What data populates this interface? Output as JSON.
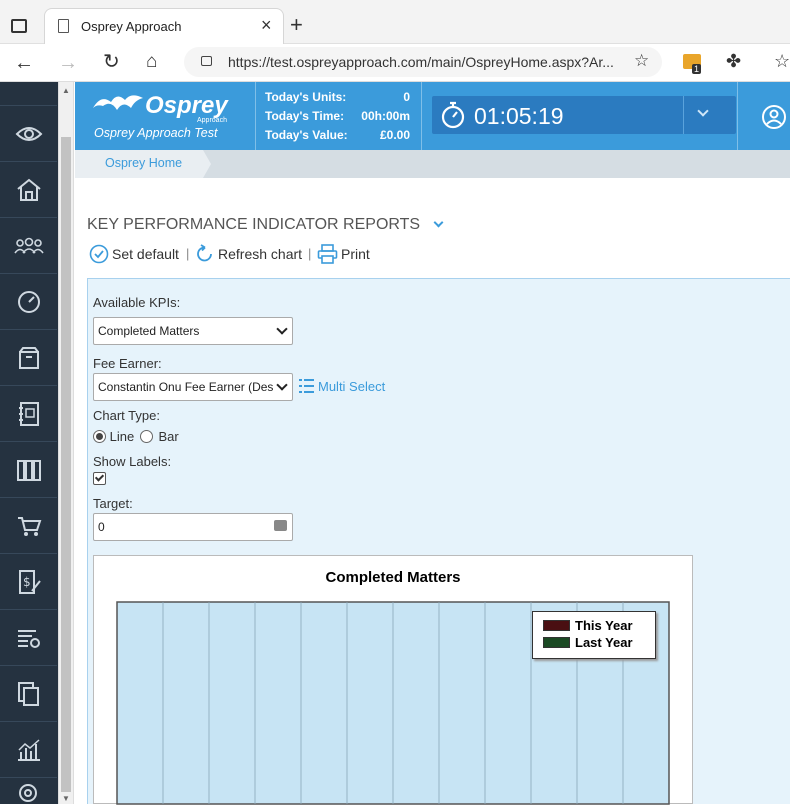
{
  "browser": {
    "tab_title": "Osprey Approach",
    "url": "https://test.ospreyapproach.com/main/OspreyHome.aspx?Ar...",
    "notification_count": "1"
  },
  "header": {
    "logo_text": "Osprey",
    "logo_sub": "Approach",
    "app_name": "Osprey Approach Test",
    "stats": [
      {
        "label": "Today's Units:",
        "value": "0"
      },
      {
        "label": "Today's Time:",
        "value": "00h:00m"
      },
      {
        "label": "Today's Value:",
        "value": "£0.00"
      }
    ],
    "timer": "01:05:19"
  },
  "breadcrumb": {
    "home": "Osprey Home"
  },
  "page": {
    "title": "KEY PERFORMANCE INDICATOR REPORTS",
    "toolbar": {
      "set_default": "Set default",
      "refresh": "Refresh chart",
      "print": "Print",
      "separator": "|"
    }
  },
  "form": {
    "kpi_label": "Available KPIs:",
    "kpi_value": "Completed Matters",
    "fee_earner_label": "Fee Earner:",
    "fee_earner_value": "Constantin Onu Fee Earner (Des",
    "multi_select": "Multi Select",
    "chart_type_label": "Chart Type:",
    "chart_type_options": [
      "Line",
      "Bar"
    ],
    "chart_type_selected": "Line",
    "show_labels_label": "Show Labels:",
    "show_labels_checked": true,
    "target_label": "Target:",
    "target_value": "0"
  },
  "chart_data": {
    "type": "line",
    "title": "Completed Matters",
    "series": [
      {
        "name": "This Year",
        "color": "#4a0f12",
        "values": []
      },
      {
        "name": "Last Year",
        "color": "#1b4a24",
        "values": []
      }
    ],
    "grid": true,
    "legend_position": "top-right",
    "plot_background": "#c7e4f4"
  },
  "colors": {
    "header": "#3b9bdb",
    "nav": "#253240",
    "timer_bg": "#2b7bc0",
    "accent": "#3b9bdb"
  }
}
